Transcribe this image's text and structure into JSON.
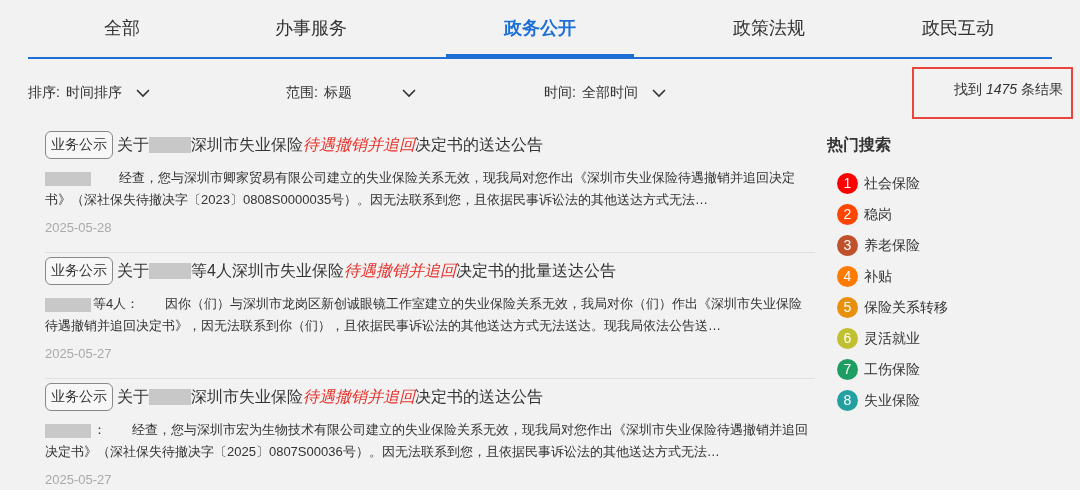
{
  "tabs": [
    {
      "label": "全部",
      "selected": false
    },
    {
      "label": "办事服务",
      "selected": false
    },
    {
      "label": "政务公开",
      "selected": true
    },
    {
      "label": "政策法规",
      "selected": false
    },
    {
      "label": "政民互动",
      "selected": false
    }
  ],
  "filters": [
    {
      "label": "排序:",
      "value": "时间排序"
    },
    {
      "label": "范围:",
      "value": "标题"
    },
    {
      "label": "时间:",
      "value": "全部时间"
    }
  ],
  "result_count": {
    "prefix": "找到",
    "count": "1475",
    "suffix": "条结果",
    "highlighted": true
  },
  "results": [
    {
      "tag": "业务公示",
      "title": [
        {
          "kind": "text",
          "text": "关于"
        },
        {
          "kind": "redacted"
        },
        {
          "kind": "text",
          "text": "深圳市失业保险"
        },
        {
          "kind": "highlight",
          "text": "待遇撤销并追回"
        },
        {
          "kind": "text",
          "text": "决定书的送达公告"
        }
      ],
      "body": [
        {
          "kind": "redacted"
        },
        {
          "kind": "text",
          "text": "　　经查，您与深圳市卿家贸易有限公司建立的失业保险关系无效，现我局对您作出《深圳市失业保险待遇撤销并追回决定书》（深社保失待撤决字〔2023〕0808S0000035号）。因无法联系到您，且依据民事诉讼法的其他送达方式无法…"
        }
      ],
      "date": "2025-05-28"
    },
    {
      "tag": "业务公示",
      "title": [
        {
          "kind": "text",
          "text": "关于"
        },
        {
          "kind": "redacted"
        },
        {
          "kind": "text",
          "text": "等4人深圳市失业保险"
        },
        {
          "kind": "highlight",
          "text": "待遇撤销并追回"
        },
        {
          "kind": "text",
          "text": "决定书的批量送达公告"
        }
      ],
      "body": [
        {
          "kind": "redacted"
        },
        {
          "kind": "text",
          "text": "等4人：　　因你（们）与深圳市龙岗区新创诚眼镜工作室建立的失业保险关系无效，我局对你（们）作出《深圳市失业保险待遇撤销并追回决定书》，因无法联系到你（们），且依据民事诉讼法的其他送达方式无法送达。现我局依法公告送…"
        }
      ],
      "date": "2025-05-27"
    },
    {
      "tag": "业务公示",
      "title": [
        {
          "kind": "text",
          "text": "关于"
        },
        {
          "kind": "redacted"
        },
        {
          "kind": "text",
          "text": "深圳市失业保险"
        },
        {
          "kind": "highlight",
          "text": "待遇撤销并追回"
        },
        {
          "kind": "text",
          "text": "决定书的送达公告"
        }
      ],
      "body": [
        {
          "kind": "redacted"
        },
        {
          "kind": "text",
          "text": "：　　经查，您与深圳市宏为生物技术有限公司建立的失业保险关系无效，现我局对您作出《深圳市失业保险待遇撤销并追回决定书》（深社保失待撤决字〔2025〕0807S00036号）。因无法联系到您，且依据民事诉讼法的其他送达方式无法…"
        }
      ],
      "date": "2025-05-27"
    }
  ],
  "hot_search": {
    "title": "热门搜索",
    "items": [
      {
        "rank": "1",
        "label": "社会保险",
        "color": "#ff0000"
      },
      {
        "rank": "2",
        "label": "稳岗",
        "color": "#ff4500"
      },
      {
        "rank": "3",
        "label": "养老保险",
        "color": "#c0502a"
      },
      {
        "rank": "4",
        "label": "补贴",
        "color": "#ff7a00"
      },
      {
        "rank": "5",
        "label": "保险关系转移",
        "color": "#e8900c"
      },
      {
        "rank": "6",
        "label": "灵活就业",
        "color": "#c0c030"
      },
      {
        "rank": "7",
        "label": "工伤保险",
        "color": "#1f9e63"
      },
      {
        "rank": "8",
        "label": "失业保险",
        "color": "#25a0a0"
      }
    ]
  }
}
